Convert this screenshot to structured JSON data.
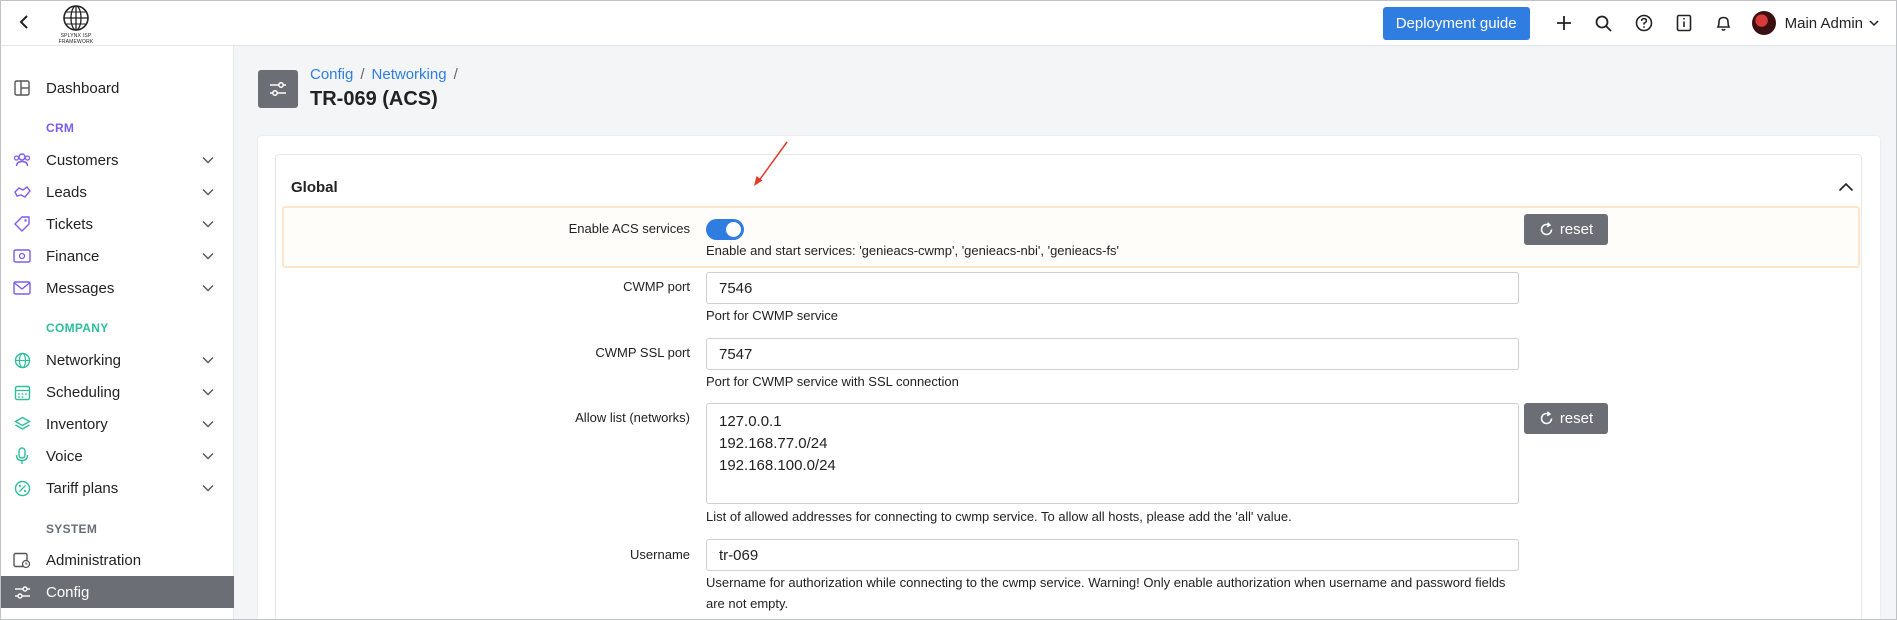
{
  "topbar": {
    "logo_text": "SPLYNX ISP FRAMEWORK",
    "deploy_label": "Deployment guide",
    "user_name": "Main Admin"
  },
  "sidebar": {
    "dashboard": "Dashboard",
    "crm_label": "CRM",
    "crm_items": [
      "Customers",
      "Leads",
      "Tickets",
      "Finance",
      "Messages"
    ],
    "company_label": "COMPANY",
    "company_items": [
      "Networking",
      "Scheduling",
      "Inventory",
      "Voice",
      "Tariff plans"
    ],
    "system_label": "SYSTEM",
    "system_items": [
      "Administration",
      "Config"
    ]
  },
  "colors": {
    "crm_label": "#7b5cf0",
    "company_label": "#2ebf9a",
    "system_label": "#6b6f75",
    "accent": "#2f7de1"
  },
  "breadcrumb": [
    "Config",
    "Networking"
  ],
  "page_title": "TR-069 (ACS)",
  "panel": {
    "title": "Global"
  },
  "fields": {
    "enable_acs": {
      "label": "Enable ACS services",
      "value": true,
      "help": "Enable and start services: 'genieacs-cwmp', 'genieacs-nbi', 'genieacs-fs'",
      "reset": "reset"
    },
    "cwmp_port": {
      "label": "CWMP port",
      "value": "7546",
      "help": "Port for CWMP service"
    },
    "cwmp_ssl_port": {
      "label": "CWMP SSL port",
      "value": "7547",
      "help": "Port for CWMP service with SSL connection"
    },
    "allow_list": {
      "label": "Allow list (networks)",
      "lines": [
        "127.0.0.1",
        "192.168.77.0/24",
        "192.168.100.0/24"
      ],
      "help": "List of allowed addresses for connecting to cwmp service. To allow all hosts, please add the 'all' value.",
      "reset": "reset"
    },
    "username": {
      "label": "Username",
      "value": "tr-069",
      "help_line1": "Username for authorization while connecting to the cwmp service. Warning! Only enable authorization when username and password fields",
      "help_line2": "are not empty."
    }
  }
}
